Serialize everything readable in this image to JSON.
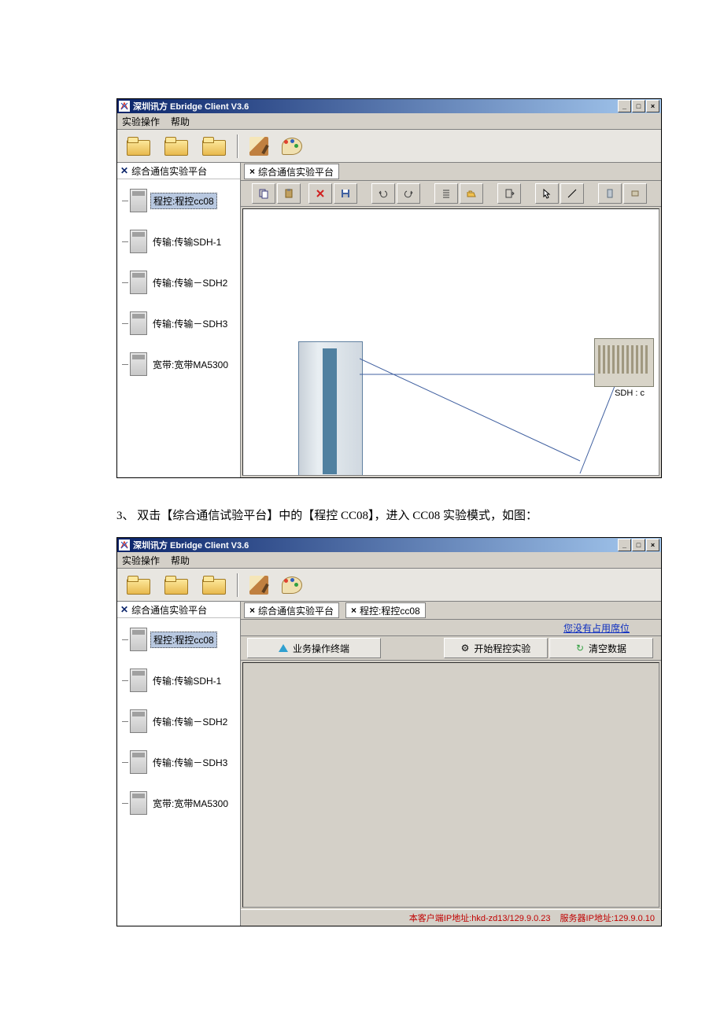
{
  "app": {
    "title": "深圳讯方 Ebridge Client V3.6",
    "menus": [
      "实验操作",
      "帮助"
    ]
  },
  "sidebar": {
    "header": "综合通信实验平台",
    "items": [
      {
        "label": "程控:程控cc08",
        "selected": true
      },
      {
        "label": "传输:传输SDH-1"
      },
      {
        "label": "传输:传输－SDH2"
      },
      {
        "label": "传输:传输－SDH3"
      },
      {
        "label": "宽带:宽带MA5300"
      }
    ]
  },
  "shot1": {
    "tab": "综合通信实验平台",
    "equip_label": "SDH : c"
  },
  "instruction": "3、 双击【综合通信试验平台】中的【程控 CC08】，进入 CC08 实验模式，如图：",
  "shot2": {
    "tabs": [
      "综合通信实验平台",
      "程控:程控cc08"
    ],
    "right_link": "您没有占用席位",
    "buttons": [
      "业务操作终端",
      "开始程控实验",
      "清空数据"
    ],
    "status_left": "本客户端IP地址:hkd-zd13/129.9.0.23",
    "status_right": "服务器IP地址:129.9.0.10"
  },
  "win_btns": {
    "min": "_",
    "max": "□",
    "close": "×"
  }
}
